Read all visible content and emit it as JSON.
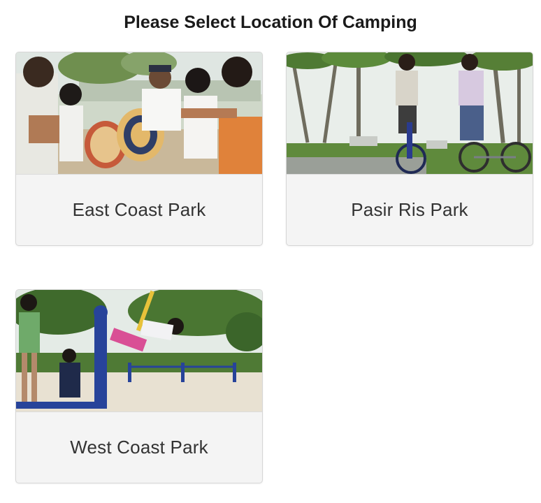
{
  "header": {
    "title": "Please Select Location Of Camping"
  },
  "locations": [
    {
      "name": "East Coast Park",
      "photo": "east-coast-park-photo"
    },
    {
      "name": "Pasir Ris Park",
      "photo": "pasir-ris-park-photo"
    },
    {
      "name": "West Coast Park",
      "photo": "west-coast-park-photo"
    }
  ],
  "colors": {
    "card_background": "#f4f4f4",
    "card_border": "#d6d6d6",
    "title_text": "#1a1a1a",
    "label_text": "#333333"
  }
}
